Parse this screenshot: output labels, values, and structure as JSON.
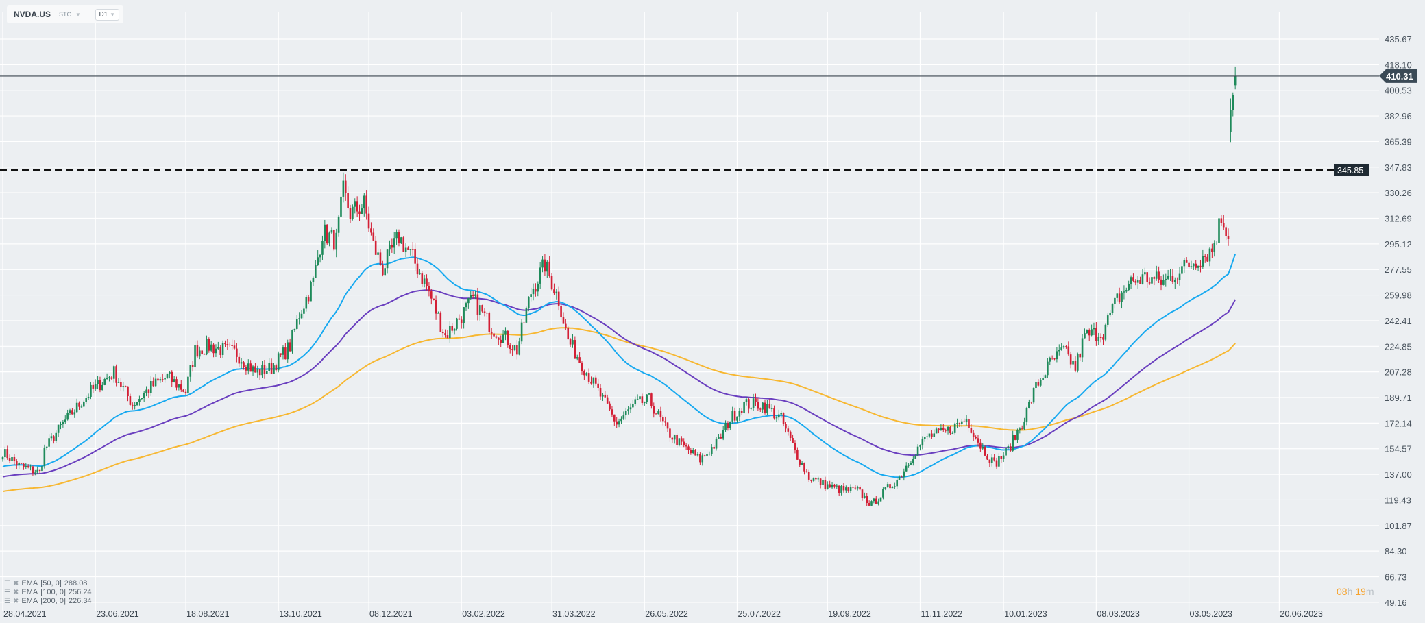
{
  "header": {
    "symbol": "NVDA.US",
    "source": "STC",
    "timeframe": "D1"
  },
  "timer": {
    "hours": "08",
    "h": "h",
    "minutes": "19",
    "m": "m"
  },
  "legend": [
    {
      "label": "EMA",
      "params": "[50,  0]",
      "value": "288.08",
      "color": "#17a9f0"
    },
    {
      "label": "EMA",
      "params": "[100,  0]",
      "value": "256.24",
      "color": "#6a3fbf"
    },
    {
      "label": "EMA",
      "params": "[200,  0]",
      "value": "226.34",
      "color": "#f7b731"
    }
  ],
  "chart_data": {
    "type": "candlestick",
    "title": "NVDA.US D1",
    "y_ticks": [
      "435.67",
      "418.10",
      "400.53",
      "382.96",
      "365.39",
      "347.83",
      "330.26",
      "312.69",
      "295.12",
      "277.55",
      "259.98",
      "242.41",
      "224.85",
      "207.28",
      "189.71",
      "172.14",
      "154.57",
      "137.00",
      "119.43",
      "101.87",
      "84.30",
      "66.73",
      "49.16"
    ],
    "ylim": [
      49.16,
      435.67
    ],
    "x_ticks": [
      "28.04.2021",
      "23.06.2021",
      "18.08.2021",
      "13.10.2021",
      "08.12.2021",
      "03.02.2022",
      "31.03.2022",
      "26.05.2022",
      "25.07.2022",
      "19.09.2022",
      "11.11.2022",
      "10.01.2023",
      "08.03.2023",
      "03.05.2023",
      "20.06.2023"
    ],
    "x_tick_days": [
      0,
      40,
      79,
      119,
      158,
      198,
      237,
      277,
      317,
      356,
      396,
      432,
      472,
      512,
      551
    ],
    "current_price": "410.31",
    "resistance_level": "345.85",
    "close_path_day_price": [
      [
        0,
        152.6
      ],
      [
        7,
        143
      ],
      [
        16,
        138
      ],
      [
        18,
        154
      ],
      [
        26,
        172
      ],
      [
        38,
        194
      ],
      [
        48,
        207
      ],
      [
        56,
        185
      ],
      [
        64,
        197
      ],
      [
        71,
        204
      ],
      [
        79,
        194
      ],
      [
        83,
        222
      ],
      [
        89,
        225
      ],
      [
        101,
        220
      ],
      [
        109,
        207
      ],
      [
        116,
        210
      ],
      [
        124,
        225
      ],
      [
        128,
        247
      ],
      [
        134,
        269
      ],
      [
        138,
        303
      ],
      [
        144,
        297
      ],
      [
        147,
        331
      ],
      [
        150,
        316
      ],
      [
        156,
        322
      ],
      [
        160,
        294
      ],
      [
        164,
        278
      ],
      [
        171,
        300
      ],
      [
        177,
        285
      ],
      [
        183,
        266
      ],
      [
        191,
        232
      ],
      [
        197,
        244
      ],
      [
        203,
        257
      ],
      [
        211,
        238
      ],
      [
        218,
        229
      ],
      [
        222,
        222
      ],
      [
        228,
        262
      ],
      [
        234,
        281
      ],
      [
        240,
        257
      ],
      [
        244,
        229
      ],
      [
        250,
        213
      ],
      [
        258,
        191
      ],
      [
        265,
        172
      ],
      [
        273,
        185
      ],
      [
        279,
        188
      ],
      [
        287,
        166
      ],
      [
        293,
        157
      ],
      [
        301,
        147
      ],
      [
        309,
        160
      ],
      [
        314,
        175
      ],
      [
        320,
        185
      ],
      [
        328,
        185
      ],
      [
        336,
        175
      ],
      [
        342,
        153
      ],
      [
        348,
        135
      ],
      [
        356,
        129
      ],
      [
        363,
        126
      ],
      [
        369,
        126
      ],
      [
        375,
        116
      ],
      [
        381,
        126
      ],
      [
        387,
        135
      ],
      [
        393,
        151
      ],
      [
        399,
        163
      ],
      [
        407,
        166
      ],
      [
        416,
        175
      ],
      [
        422,
        157
      ],
      [
        428,
        144
      ],
      [
        434,
        154
      ],
      [
        440,
        172
      ],
      [
        446,
        197
      ],
      [
        452,
        213
      ],
      [
        458,
        222
      ],
      [
        463,
        210
      ],
      [
        467,
        232
      ],
      [
        475,
        235
      ],
      [
        481,
        257
      ],
      [
        487,
        269
      ],
      [
        493,
        272
      ],
      [
        501,
        269
      ],
      [
        509,
        278
      ],
      [
        516,
        285
      ],
      [
        522,
        291
      ],
      [
        526,
        313
      ],
      [
        529,
        303
      ],
      [
        530,
        387
      ],
      [
        532,
        410.31
      ]
    ],
    "ema_seed": {
      "ema50": 142,
      "ema100": 135,
      "ema200": 125
    },
    "series": [
      {
        "name": "EMA 50",
        "last": 288.08,
        "color": "#17a9f0"
      },
      {
        "name": "EMA 100",
        "last": 256.24,
        "color": "#6a3fbf"
      },
      {
        "name": "EMA 200",
        "last": 226.34,
        "color": "#f7b731"
      }
    ],
    "up_color": "#1e8a5a",
    "down_color": "#d31f35"
  }
}
